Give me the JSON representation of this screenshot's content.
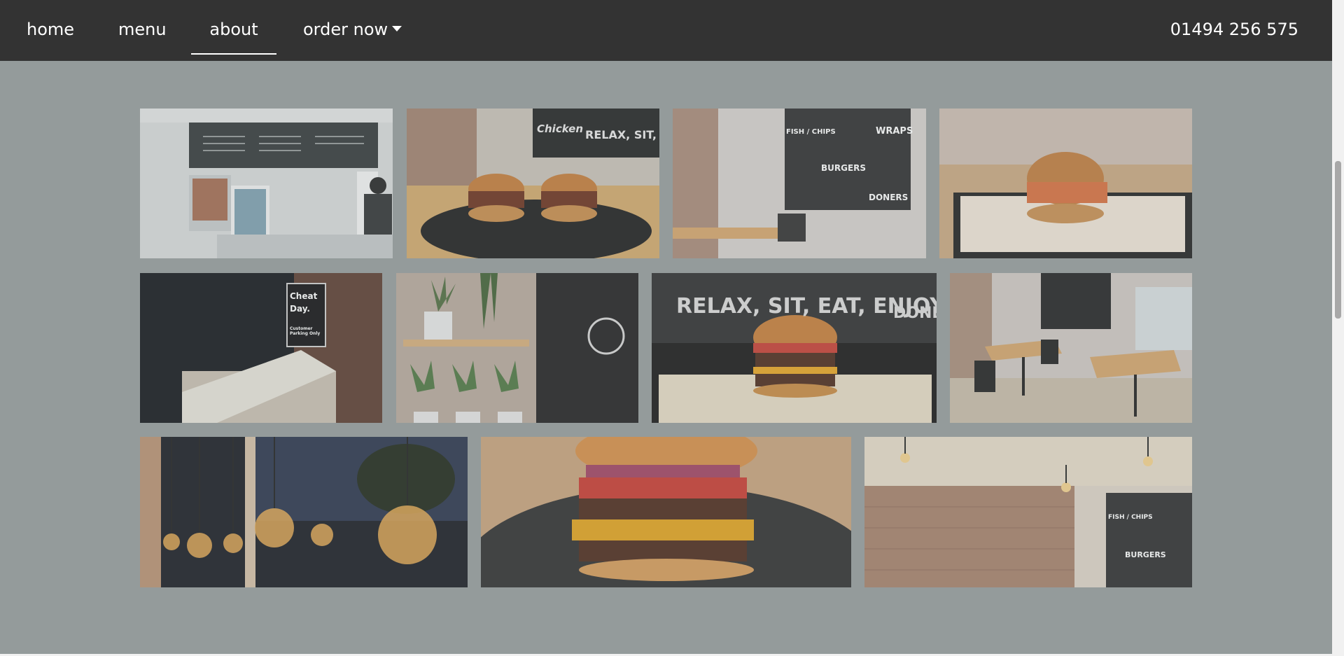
{
  "nav": {
    "items": [
      {
        "label": "home"
      },
      {
        "label": "menu"
      },
      {
        "label": "about"
      },
      {
        "label": "order now"
      }
    ],
    "phone": "01494 256 575"
  },
  "photo_text": {
    "relax_board": "RELAX, SIT, EAT, ENJOY!",
    "sign": "Cheat Day.",
    "sign_sub": "Customer Parking Only",
    "burgers": "BURGERS",
    "doners": "DONERS",
    "fish_chips": "FISH / CHIPS",
    "wraps": "WRAPS",
    "chicken": "Chicken",
    "relax_short": "RELAX, SIT, EA"
  },
  "colors": {
    "nav_bg": "#333333",
    "page_bg": "#949b9b",
    "nav_text": "#ffffff"
  }
}
